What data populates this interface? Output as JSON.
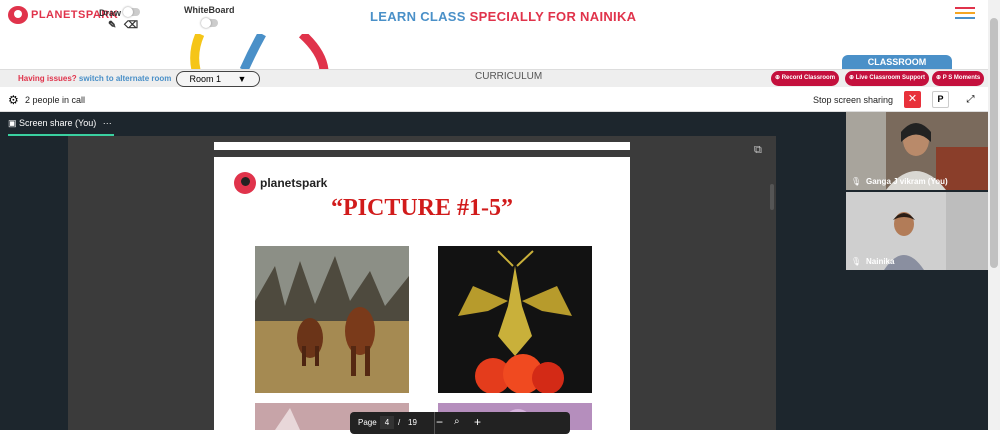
{
  "brand": {
    "name": "PLANETSPARK",
    "color": "#e0334b"
  },
  "tools": {
    "draw": "Draw",
    "whiteboard": "WhiteBoard",
    "pencil_icon": "pencil-icon",
    "eraser_icon": "eraser-icon"
  },
  "title": {
    "part1": "LEARN CLASS",
    "part2": "SPECIALLY FOR NAINIKA",
    "color1": "#4a90c8",
    "color2": "#e0334b"
  },
  "classroom_tab": "CLASSROOM",
  "subbar": {
    "issue_text": "Having issues?",
    "alt_link": "switch to alternate room",
    "room_label": "Room 1",
    "curriculum": "CURRICULUM",
    "buttons": [
      "Record Classroom",
      "Live Classroom Support",
      "P S Moments"
    ]
  },
  "call": {
    "people": "2 people in call",
    "stop_share": "Stop screen sharing",
    "p_btn": "P"
  },
  "share": {
    "tab": "Screen share (You)",
    "menu": "···"
  },
  "doc": {
    "brand": "planetspark",
    "title": "“PICTURE #1-5”"
  },
  "pager": {
    "label": "Page",
    "current": "4",
    "sep": "/",
    "total": "19"
  },
  "participants": [
    {
      "name": "Ganga J vikram (You)"
    },
    {
      "name": "Nainika"
    }
  ]
}
